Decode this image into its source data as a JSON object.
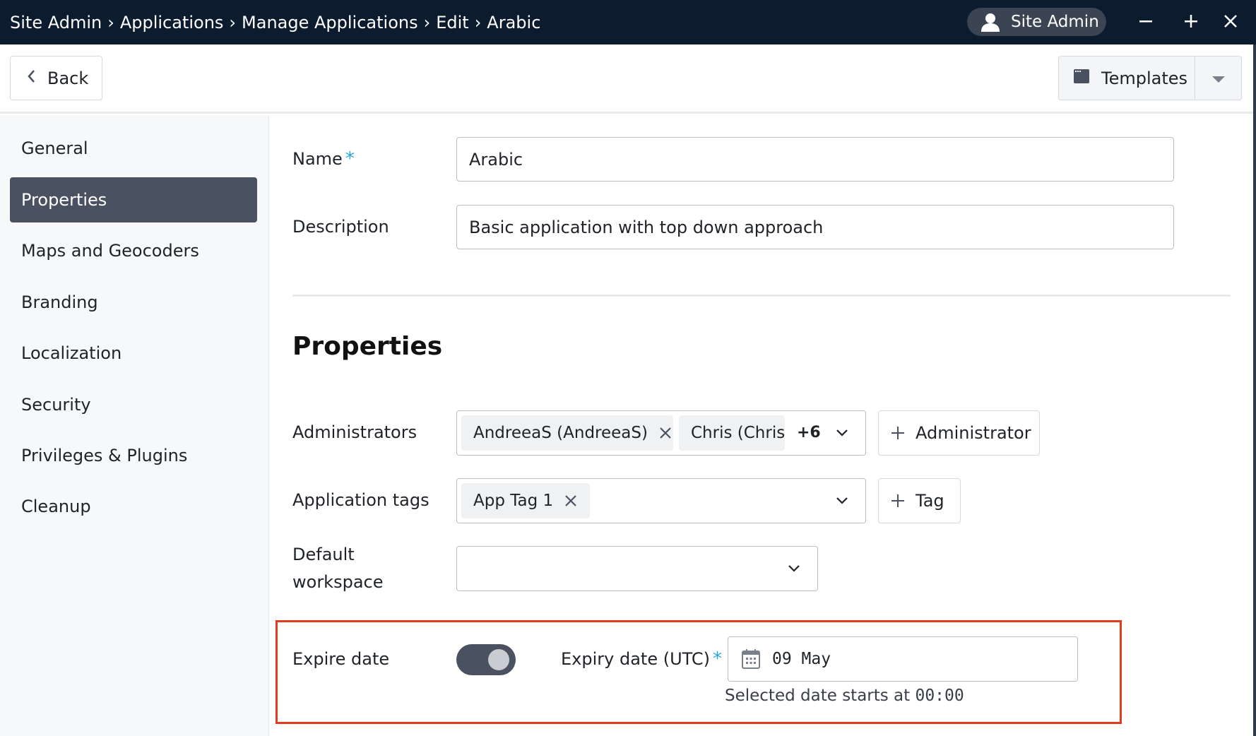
{
  "titlebar": {
    "breadcrumb": [
      "Site Admin",
      "Applications",
      "Manage Applications",
      "Edit",
      "Arabic"
    ],
    "separator": "›",
    "user_label": "Site Admin",
    "bg_color": "#0d1b2e"
  },
  "toolbar": {
    "back_label": "Back",
    "templates_label": "Templates"
  },
  "sidebar": {
    "items": [
      {
        "label": "General"
      },
      {
        "label": "Properties",
        "active": true
      },
      {
        "label": "Maps and Geocoders"
      },
      {
        "label": "Branding"
      },
      {
        "label": "Localization"
      },
      {
        "label": "Security"
      },
      {
        "label": "Privileges & Plugins"
      },
      {
        "label": "Cleanup"
      }
    ]
  },
  "form": {
    "name_label": "Name",
    "required_mark": "*",
    "name_value": "Arabic",
    "description_label": "Description",
    "description_value": "Basic application with top down approach",
    "section_title": "Properties",
    "administrators_label": "Administrators",
    "administrator_chips": [
      "AndreeaS (AndreeaS)",
      "Chris (Chris)"
    ],
    "administrators_more": "+6",
    "add_administrator_label": "Administrator",
    "app_tags_label": "Application tags",
    "app_tag_chips": [
      "App Tag 1"
    ],
    "add_tag_label": "Tag",
    "default_workspace_label_line1": "Default",
    "default_workspace_label_line2": "workspace",
    "default_workspace_value": "",
    "expire_date_label": "Expire date",
    "expire_toggle_on": true,
    "expiry_date_label": "Expiry date (UTC)",
    "expiry_date_value": "09 May",
    "hint_prefix": "Selected date starts at ",
    "hint_time": "00:00"
  },
  "colors": {
    "accent_required": "#29a8d8",
    "active_nav": "#4a5160",
    "highlight": "#e03c1f"
  }
}
